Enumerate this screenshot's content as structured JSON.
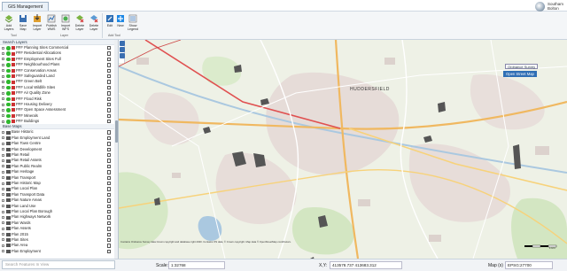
{
  "window": {
    "tab_label": "GIS Management",
    "user_name": "Southam",
    "user_sub": "Bolton"
  },
  "ribbon": {
    "buttons": [
      {
        "label": "Add Layers",
        "icon": "add-layers-icon"
      },
      {
        "label": "Save Map",
        "icon": "save-map-icon"
      },
      {
        "label": "Import Layer",
        "icon": "import-layer-icon"
      },
      {
        "label": "Publish WMS",
        "icon": "publish-icon"
      },
      {
        "label": "Import WFS",
        "icon": "import-wfs-icon"
      },
      {
        "label": "Delete Layer",
        "icon": "delete-layer-icon"
      },
      {
        "label": "Delete Layer",
        "icon": "delete-layer-icon"
      },
      {
        "label": "Edit",
        "icon": "edit-icon"
      },
      {
        "label": "New",
        "icon": "new-icon"
      },
      {
        "label": "Show Legend",
        "icon": "legend-icon"
      }
    ],
    "groups": [
      "Tool",
      "Layer",
      "Add Tool"
    ]
  },
  "layers": {
    "section_top": "Search Layers",
    "layer_rows": [
      "PFF Planning Sites Commercial",
      "PFF Residential Allocations",
      "PFF Employment Sites Full",
      "PFF Neighbourhood Plans",
      "PFF Conservation Areas",
      "PFF Safeguarded Land",
      "PFF Green Belt",
      "PFF Local Wildlife Sites",
      "PFF Air Quality Zone",
      "PFF Flood Risk",
      "PFF Housing Delivery",
      "PFF Open Space Assessment",
      "PFF Minerals",
      "PFF Buildings"
    ],
    "section_group": "Base Maps",
    "group_rows": [
      "Base Historic",
      "Plan Employment Land",
      "Plan Town Centre",
      "Plan Development",
      "Plan Retail",
      "Plan Retail Assets",
      "Plan Public Realm",
      "Plan Heritage",
      "Plan Transport",
      "Plan Historic Map",
      "Plan Local Plan",
      "Plan Transport Data",
      "Plan Nature Areas",
      "Plan Land Use",
      "Plan Local Plan Borough",
      "Plan Highways Network",
      "Plan Wards",
      "Plan Assets",
      "Plan 2015",
      "Plan Sites",
      "Plan Area",
      "Plan Employment"
    ],
    "search_placeholder": "Search Features In View"
  },
  "map": {
    "town_label": "HUDDERSFIELD",
    "top_label": "Ordnance Survey",
    "selected_label": "Open Street Map",
    "attribution": "Contains Ordnance Survey data Crown copyright and database right 2020. Contains OS data, © Crown copyright. Map data © OpenStreetMap contributors.",
    "scale_bar_label": "1 km"
  },
  "status": {
    "scale_label": "Scale:",
    "scale_value": "1:32768",
    "xy_label": "X,Y:",
    "xy_value": "413578.737  413683.312",
    "map_label": "Map (s)",
    "map_value": "EPSG:27700"
  },
  "colors": {
    "accent": "#2f6fb5",
    "layer_on": "#2eb82e"
  }
}
